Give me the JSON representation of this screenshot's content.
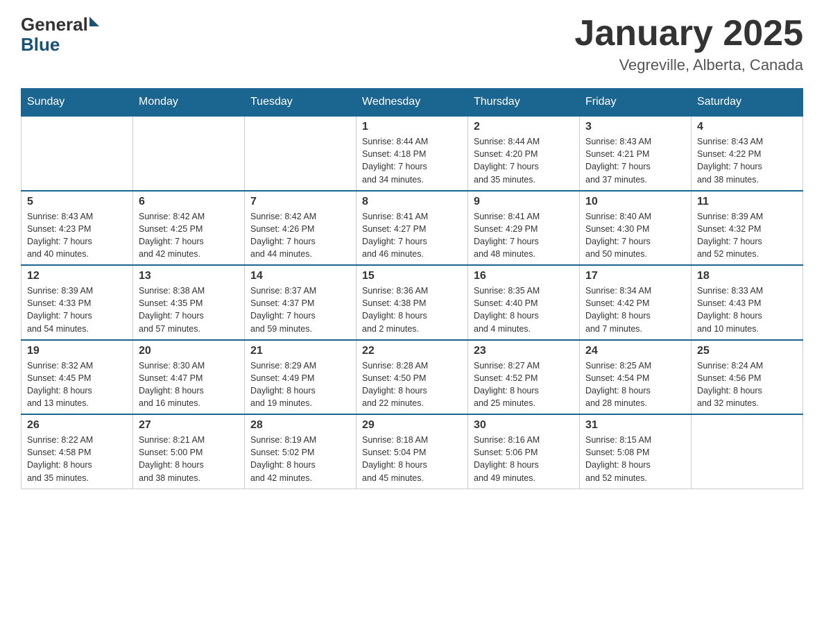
{
  "header": {
    "logo_general": "General",
    "logo_blue": "Blue",
    "month_title": "January 2025",
    "location": "Vegreville, Alberta, Canada"
  },
  "days_of_week": [
    "Sunday",
    "Monday",
    "Tuesday",
    "Wednesday",
    "Thursday",
    "Friday",
    "Saturday"
  ],
  "weeks": [
    [
      {
        "day": "",
        "info": ""
      },
      {
        "day": "",
        "info": ""
      },
      {
        "day": "",
        "info": ""
      },
      {
        "day": "1",
        "info": "Sunrise: 8:44 AM\nSunset: 4:18 PM\nDaylight: 7 hours\nand 34 minutes."
      },
      {
        "day": "2",
        "info": "Sunrise: 8:44 AM\nSunset: 4:20 PM\nDaylight: 7 hours\nand 35 minutes."
      },
      {
        "day": "3",
        "info": "Sunrise: 8:43 AM\nSunset: 4:21 PM\nDaylight: 7 hours\nand 37 minutes."
      },
      {
        "day": "4",
        "info": "Sunrise: 8:43 AM\nSunset: 4:22 PM\nDaylight: 7 hours\nand 38 minutes."
      }
    ],
    [
      {
        "day": "5",
        "info": "Sunrise: 8:43 AM\nSunset: 4:23 PM\nDaylight: 7 hours\nand 40 minutes."
      },
      {
        "day": "6",
        "info": "Sunrise: 8:42 AM\nSunset: 4:25 PM\nDaylight: 7 hours\nand 42 minutes."
      },
      {
        "day": "7",
        "info": "Sunrise: 8:42 AM\nSunset: 4:26 PM\nDaylight: 7 hours\nand 44 minutes."
      },
      {
        "day": "8",
        "info": "Sunrise: 8:41 AM\nSunset: 4:27 PM\nDaylight: 7 hours\nand 46 minutes."
      },
      {
        "day": "9",
        "info": "Sunrise: 8:41 AM\nSunset: 4:29 PM\nDaylight: 7 hours\nand 48 minutes."
      },
      {
        "day": "10",
        "info": "Sunrise: 8:40 AM\nSunset: 4:30 PM\nDaylight: 7 hours\nand 50 minutes."
      },
      {
        "day": "11",
        "info": "Sunrise: 8:39 AM\nSunset: 4:32 PM\nDaylight: 7 hours\nand 52 minutes."
      }
    ],
    [
      {
        "day": "12",
        "info": "Sunrise: 8:39 AM\nSunset: 4:33 PM\nDaylight: 7 hours\nand 54 minutes."
      },
      {
        "day": "13",
        "info": "Sunrise: 8:38 AM\nSunset: 4:35 PM\nDaylight: 7 hours\nand 57 minutes."
      },
      {
        "day": "14",
        "info": "Sunrise: 8:37 AM\nSunset: 4:37 PM\nDaylight: 7 hours\nand 59 minutes."
      },
      {
        "day": "15",
        "info": "Sunrise: 8:36 AM\nSunset: 4:38 PM\nDaylight: 8 hours\nand 2 minutes."
      },
      {
        "day": "16",
        "info": "Sunrise: 8:35 AM\nSunset: 4:40 PM\nDaylight: 8 hours\nand 4 minutes."
      },
      {
        "day": "17",
        "info": "Sunrise: 8:34 AM\nSunset: 4:42 PM\nDaylight: 8 hours\nand 7 minutes."
      },
      {
        "day": "18",
        "info": "Sunrise: 8:33 AM\nSunset: 4:43 PM\nDaylight: 8 hours\nand 10 minutes."
      }
    ],
    [
      {
        "day": "19",
        "info": "Sunrise: 8:32 AM\nSunset: 4:45 PM\nDaylight: 8 hours\nand 13 minutes."
      },
      {
        "day": "20",
        "info": "Sunrise: 8:30 AM\nSunset: 4:47 PM\nDaylight: 8 hours\nand 16 minutes."
      },
      {
        "day": "21",
        "info": "Sunrise: 8:29 AM\nSunset: 4:49 PM\nDaylight: 8 hours\nand 19 minutes."
      },
      {
        "day": "22",
        "info": "Sunrise: 8:28 AM\nSunset: 4:50 PM\nDaylight: 8 hours\nand 22 minutes."
      },
      {
        "day": "23",
        "info": "Sunrise: 8:27 AM\nSunset: 4:52 PM\nDaylight: 8 hours\nand 25 minutes."
      },
      {
        "day": "24",
        "info": "Sunrise: 8:25 AM\nSunset: 4:54 PM\nDaylight: 8 hours\nand 28 minutes."
      },
      {
        "day": "25",
        "info": "Sunrise: 8:24 AM\nSunset: 4:56 PM\nDaylight: 8 hours\nand 32 minutes."
      }
    ],
    [
      {
        "day": "26",
        "info": "Sunrise: 8:22 AM\nSunset: 4:58 PM\nDaylight: 8 hours\nand 35 minutes."
      },
      {
        "day": "27",
        "info": "Sunrise: 8:21 AM\nSunset: 5:00 PM\nDaylight: 8 hours\nand 38 minutes."
      },
      {
        "day": "28",
        "info": "Sunrise: 8:19 AM\nSunset: 5:02 PM\nDaylight: 8 hours\nand 42 minutes."
      },
      {
        "day": "29",
        "info": "Sunrise: 8:18 AM\nSunset: 5:04 PM\nDaylight: 8 hours\nand 45 minutes."
      },
      {
        "day": "30",
        "info": "Sunrise: 8:16 AM\nSunset: 5:06 PM\nDaylight: 8 hours\nand 49 minutes."
      },
      {
        "day": "31",
        "info": "Sunrise: 8:15 AM\nSunset: 5:08 PM\nDaylight: 8 hours\nand 52 minutes."
      },
      {
        "day": "",
        "info": ""
      }
    ]
  ]
}
